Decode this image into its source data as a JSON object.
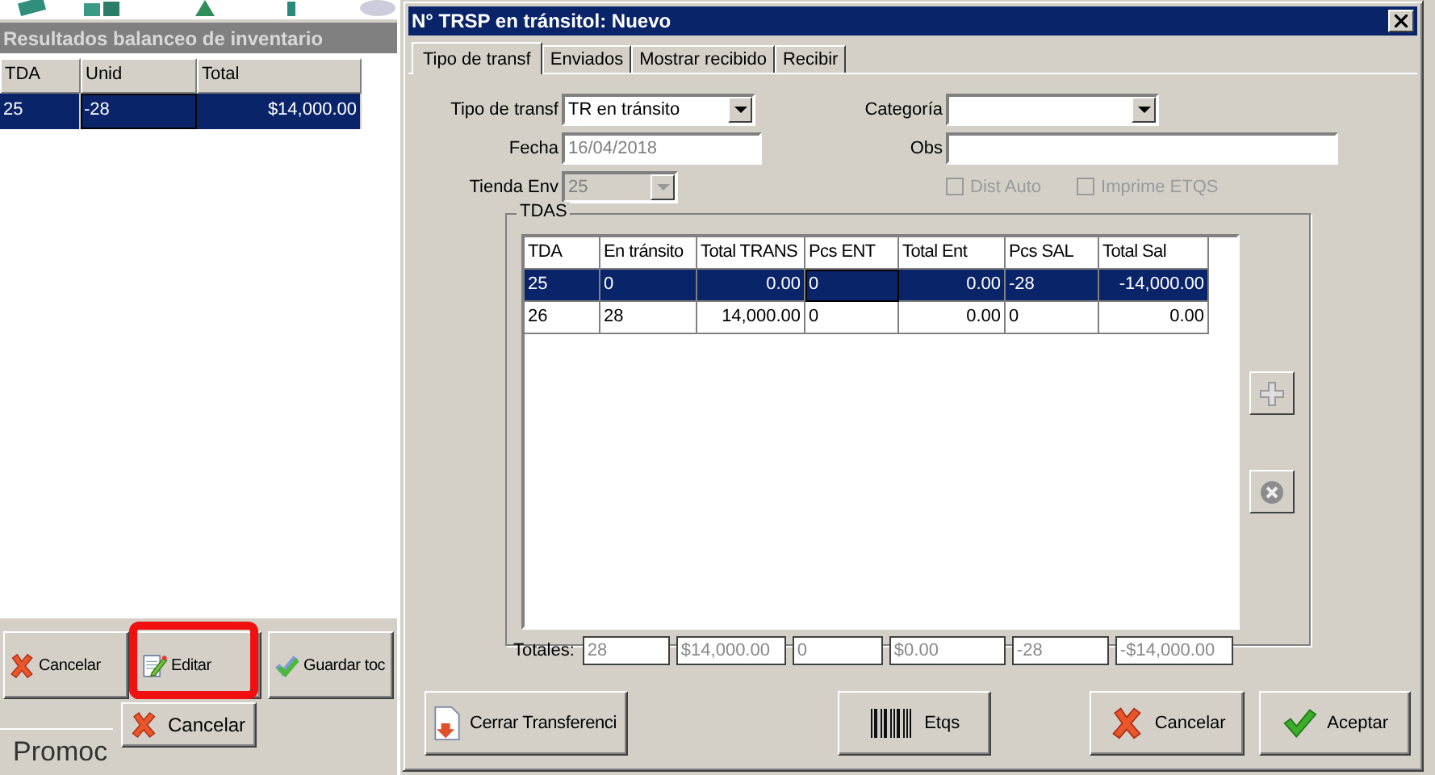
{
  "background_window": {
    "title": "Resultados balanceo de inventario",
    "table": {
      "columns": [
        "TDA",
        "Unid",
        "Total"
      ],
      "rows": [
        {
          "cells": [
            "25",
            "-28",
            "$14,000.00"
          ],
          "selected": true
        }
      ]
    },
    "buttons": [
      {
        "label": "Cancelar",
        "kind": "cancel",
        "highlighted": false
      },
      {
        "label": "Editar",
        "kind": "edit",
        "highlighted": true
      },
      {
        "label": "Guardar toc",
        "kind": "save",
        "highlighted": false
      }
    ],
    "tab_label": "Promoc",
    "behind_button": "Cancelar"
  },
  "dialog": {
    "title": "N° TRSP en tránsitol: Nuevo",
    "tabs": [
      {
        "label": "Tipo de transf",
        "selected": true
      },
      {
        "label": "Enviados",
        "selected": false
      },
      {
        "label": "Mostrar recibido",
        "selected": false
      },
      {
        "label": "Recibir",
        "selected": false
      }
    ],
    "fields": [
      {
        "label": "Tipo de transf",
        "kind": "combo",
        "value": "TR en tránsito",
        "disabled": false
      },
      {
        "label": "Fecha",
        "kind": "text",
        "value": "16/04/2018",
        "disabled": true
      },
      {
        "label": "Tienda Env",
        "kind": "combo",
        "value": "25",
        "disabled": true
      }
    ],
    "right_fields": [
      {
        "label": "Categoría",
        "kind": "combo"
      },
      {
        "label": "Obs",
        "kind": "text"
      }
    ],
    "checkboxes": [
      {
        "label": "Dist Auto",
        "checked": false,
        "disabled": true
      },
      {
        "label": "Imprime ETQS",
        "checked": false,
        "disabled": true
      }
    ],
    "group_title": "TDAS",
    "grid": {
      "columns": [
        "TDA",
        "En tránsito",
        "Total TRANS",
        "Pcs ENT",
        "Total Ent",
        "Pcs SAL",
        "Total Sal"
      ],
      "rows": [
        {
          "cells": [
            "25",
            "0",
            "0.00",
            "0",
            "0.00",
            "-28",
            "-14,000.00"
          ],
          "selected": true
        },
        {
          "cells": [
            "26",
            "28",
            "14,000.00",
            "0",
            "0.00",
            "0",
            "0.00"
          ],
          "selected": false
        }
      ]
    },
    "totals_label": "Totales:",
    "totals": [
      "28",
      "$14,000.00",
      "0",
      "$0.00",
      "-28",
      "-$14,000.00"
    ],
    "side_buttons": [
      {
        "kind": "add"
      },
      {
        "kind": "remove"
      }
    ],
    "buttons": [
      {
        "label": "Cerrar Transferenci",
        "kind": "close_transfer"
      },
      {
        "label": "Etqs",
        "kind": "labels"
      },
      {
        "label": "Cancelar",
        "kind": "cancel"
      },
      {
        "label": "Aceptar",
        "kind": "accept"
      }
    ]
  }
}
